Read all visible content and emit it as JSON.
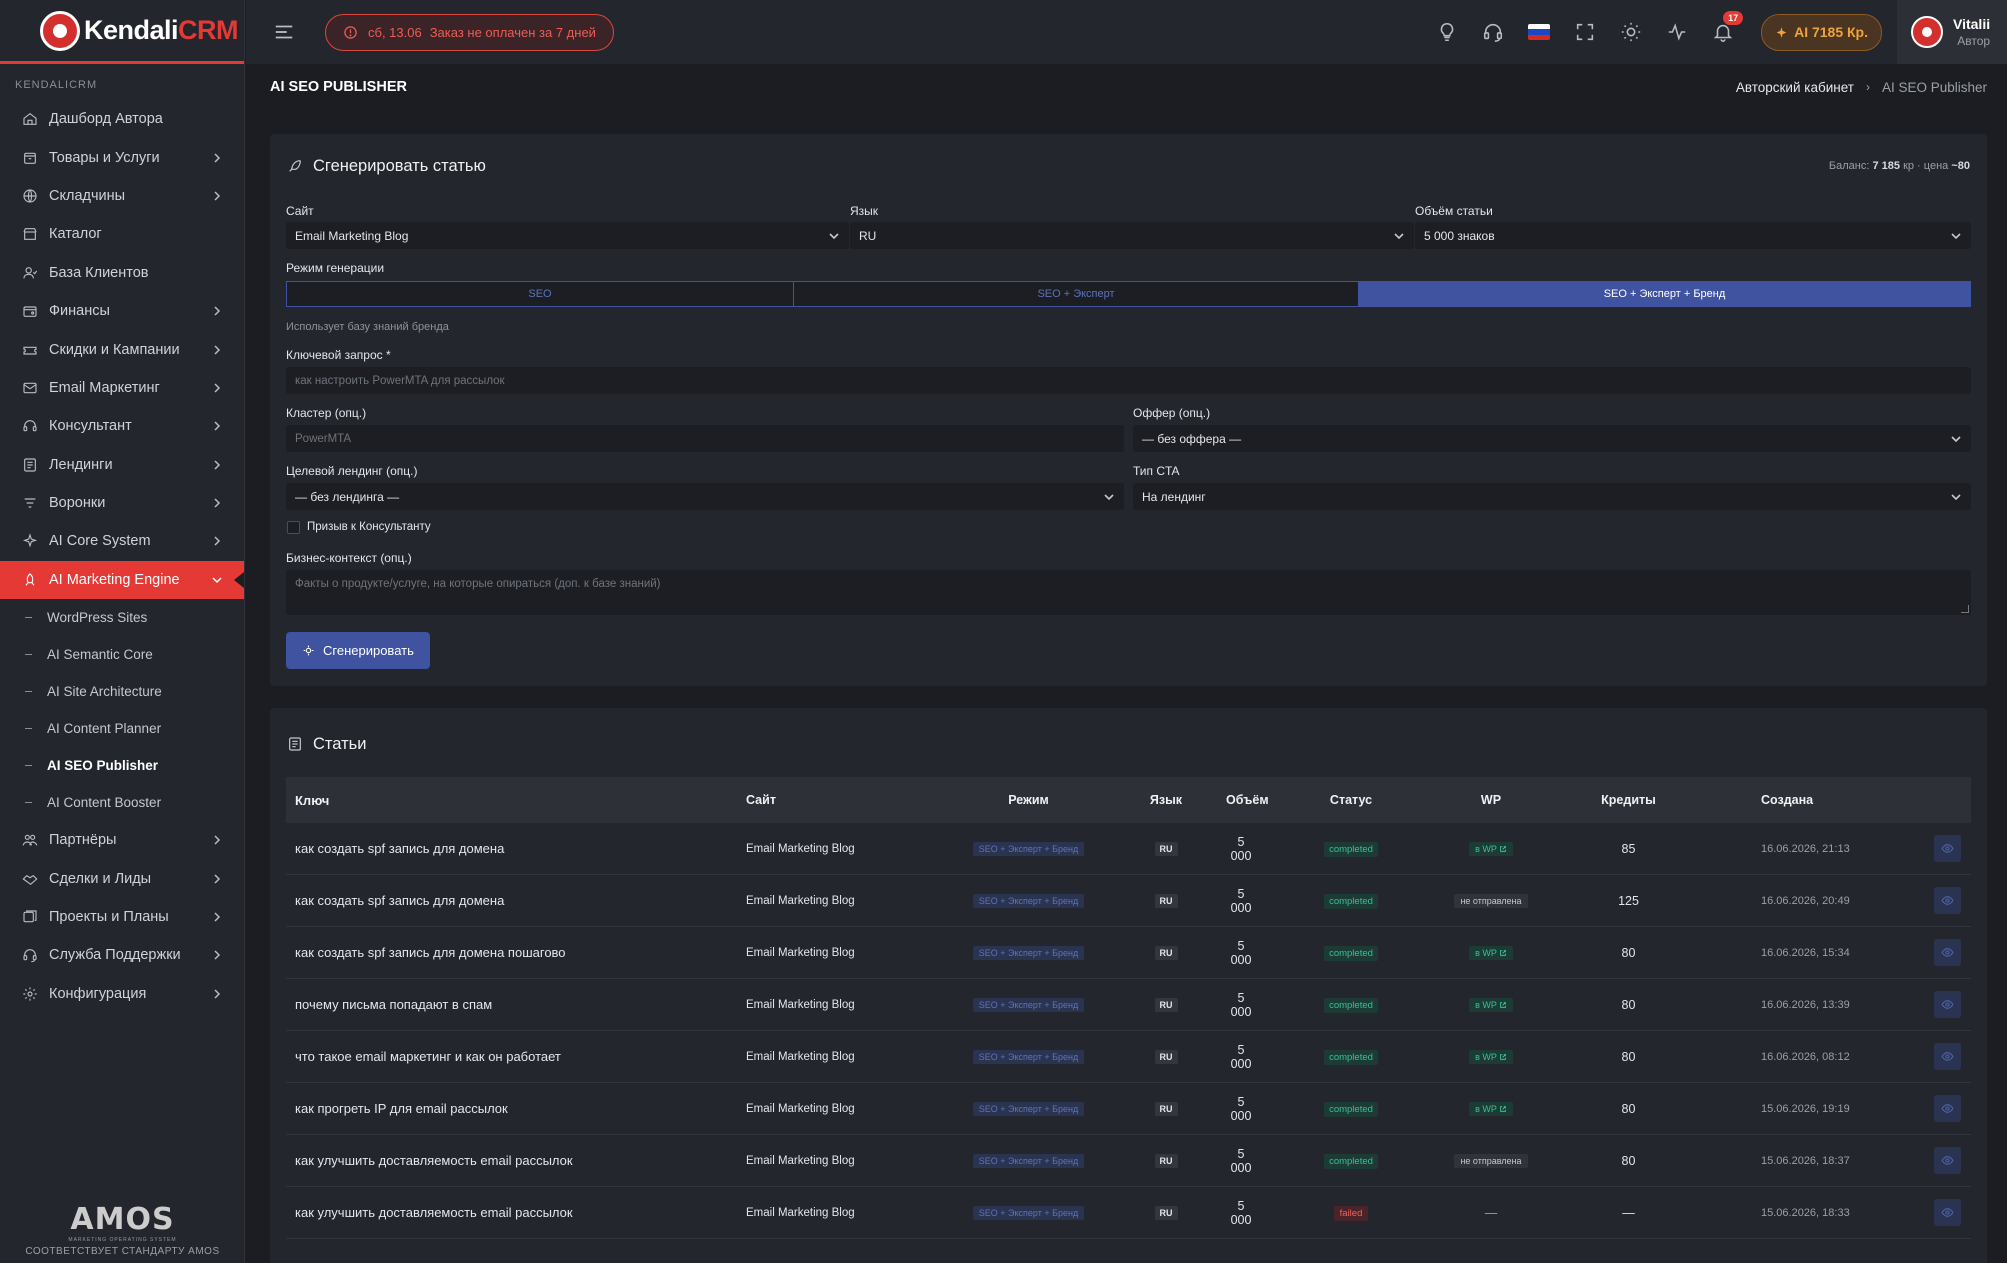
{
  "app": {
    "logo_text_main": "Kendali",
    "logo_text_accent": "CRM"
  },
  "sidebar": {
    "section": "KENDALICRM",
    "items": [
      {
        "label": "Дашборд Автора",
        "icon": "home-icon",
        "chevron": false
      },
      {
        "label": "Товары и Услуги",
        "icon": "box-icon",
        "chevron": true
      },
      {
        "label": "Складчины",
        "icon": "globe-icon",
        "chevron": true
      },
      {
        "label": "Каталог",
        "icon": "store-icon",
        "chevron": false
      },
      {
        "label": "База Клиентов",
        "icon": "users-icon",
        "chevron": false
      },
      {
        "label": "Финансы",
        "icon": "wallet-icon",
        "chevron": true
      },
      {
        "label": "Скидки и Кампании",
        "icon": "ticket-icon",
        "chevron": true
      },
      {
        "label": "Email Маркетинг",
        "icon": "mail-icon",
        "chevron": true
      },
      {
        "label": "Консультант",
        "icon": "headset-icon",
        "chevron": true
      },
      {
        "label": "Лендинги",
        "icon": "layout-icon",
        "chevron": true
      },
      {
        "label": "Воронки",
        "icon": "filter-icon",
        "chevron": true
      },
      {
        "label": "AI Core System",
        "icon": "sparkle-icon",
        "chevron": true
      },
      {
        "label": "AI Marketing Engine",
        "icon": "rocket-icon",
        "chevron": true,
        "active": true
      }
    ],
    "subitems": [
      {
        "label": "WordPress Sites"
      },
      {
        "label": "AI Semantic Core"
      },
      {
        "label": "AI Site Architecture"
      },
      {
        "label": "AI Content Planner"
      },
      {
        "label": "AI SEO Publisher",
        "current": true
      },
      {
        "label": "AI Content Booster"
      }
    ],
    "items_after": [
      {
        "label": "Партнёры",
        "icon": "partners-icon",
        "chevron": true
      },
      {
        "label": "Сделки и Лиды",
        "icon": "handshake-icon",
        "chevron": true
      },
      {
        "label": "Проекты и Планы",
        "icon": "projects-icon",
        "chevron": true
      },
      {
        "label": "Служба Поддержки",
        "icon": "support-icon",
        "chevron": true
      },
      {
        "label": "Конфигурация",
        "icon": "gear-icon",
        "chevron": true
      }
    ],
    "footer_logo": "AMOS",
    "footer_tagline": "MARKETING OPERATING SYSTEM",
    "footer_caption": "СООТВЕТСТВУЕТ СТАНДАРТУ AMOS"
  },
  "topbar": {
    "alert_date": "сб, 13.06",
    "alert_text": "Заказ не оплачен за 7 дней",
    "notif_count": "17",
    "credits_label": "AI 7185 Кр.",
    "user_name": "Vitalii",
    "user_role": "Автор"
  },
  "page": {
    "title": "AI SEO PUBLISHER",
    "breadcrumb_parent": "Авторский кабинет",
    "breadcrumb_current": "AI SEO Publisher"
  },
  "generate": {
    "title": "Сгенерировать статью",
    "balance_label": "Баланс:",
    "balance_value": "7 185",
    "balance_unit": "кр · цена",
    "price_value": "~80",
    "site_label": "Сайт",
    "site_value": "Email Marketing Blog",
    "lang_label": "Язык",
    "lang_value": "RU",
    "volume_label": "Объём статьи",
    "volume_value": "5 000 знаков",
    "mode_label": "Режим генерации",
    "modes": [
      "SEO",
      "SEO + Эксперт",
      "SEO + Эксперт + Бренд"
    ],
    "mode_hint": "Использует базу знаний бренда",
    "keyword_label": "Ключевой запрос *",
    "keyword_placeholder": "как настроить PowerMTA для рассылок",
    "cluster_label": "Кластер (опц.)",
    "cluster_placeholder": "PowerMTA",
    "offer_label": "Оффер (опц.)",
    "offer_value": "— без оффера —",
    "landing_label": "Целевой лендинг (опц.)",
    "landing_value": "— без лендинга —",
    "cta_label": "Тип CTA",
    "cta_value": "На лендинг",
    "consultant_label": "Призыв к Консультанту",
    "context_label": "Бизнес-контекст (опц.)",
    "context_placeholder": "Факты о продукте/услуге, на которые опираться (доп. к базе знаний)",
    "button_label": "Сгенерировать"
  },
  "articles": {
    "title": "Статьи",
    "columns": [
      "Ключ",
      "Сайт",
      "Режим",
      "Язык",
      "Объём",
      "Статус",
      "WP",
      "Кредиты",
      "Создана"
    ],
    "rows": [
      {
        "key": "как создать spf запись для домена",
        "site": "Email Marketing Blog",
        "mode": "SEO + Эксперт + Бренд",
        "lang": "RU",
        "volume": "5 000",
        "status": "completed",
        "wp": "в WP",
        "credits": "85",
        "created": "16.06.2026, 21:13"
      },
      {
        "key": "как создать spf запись для домена",
        "site": "Email Marketing Blog",
        "mode": "SEO + Эксперт + Бренд",
        "lang": "RU",
        "volume": "5 000",
        "status": "completed",
        "wp": "не отправлена",
        "credits": "125",
        "created": "16.06.2026, 20:49"
      },
      {
        "key": "как создать spf запись для домена пошагово",
        "site": "Email Marketing Blog",
        "mode": "SEO + Эксперт + Бренд",
        "lang": "RU",
        "volume": "5 000",
        "status": "completed",
        "wp": "в WP",
        "credits": "80",
        "created": "16.06.2026, 15:34"
      },
      {
        "key": "почему письма попадают в спам",
        "site": "Email Marketing Blog",
        "mode": "SEO + Эксперт + Бренд",
        "lang": "RU",
        "volume": "5 000",
        "status": "completed",
        "wp": "в WP",
        "credits": "80",
        "created": "16.06.2026, 13:39"
      },
      {
        "key": "что такое email маркетинг и как он работает",
        "site": "Email Marketing Blog",
        "mode": "SEO + Эксперт + Бренд",
        "lang": "RU",
        "volume": "5 000",
        "status": "completed",
        "wp": "в WP",
        "credits": "80",
        "created": "16.06.2026, 08:12"
      },
      {
        "key": "как прогреть IP для email рассылок",
        "site": "Email Marketing Blog",
        "mode": "SEO + Эксперт + Бренд",
        "lang": "RU",
        "volume": "5 000",
        "status": "completed",
        "wp": "в WP",
        "credits": "80",
        "created": "15.06.2026, 19:19"
      },
      {
        "key": "как улучшить доставляемость email рассылок",
        "site": "Email Marketing Blog",
        "mode": "SEO + Эксперт + Бренд",
        "lang": "RU",
        "volume": "5 000",
        "status": "completed",
        "wp": "не отправлена",
        "credits": "80",
        "created": "15.06.2026, 18:37"
      },
      {
        "key": "как улучшить доставляемость email рассылок",
        "site": "Email Marketing Blog",
        "mode": "SEO + Эксперт + Бренд",
        "lang": "RU",
        "volume": "5 000",
        "status": "failed",
        "wp": "—",
        "credits": "—",
        "created": "15.06.2026, 18:33"
      }
    ]
  },
  "colors": {
    "accent": "#e53935",
    "primary": "#3f53a0",
    "success": "#35c292",
    "warning": "#f0a33a"
  }
}
